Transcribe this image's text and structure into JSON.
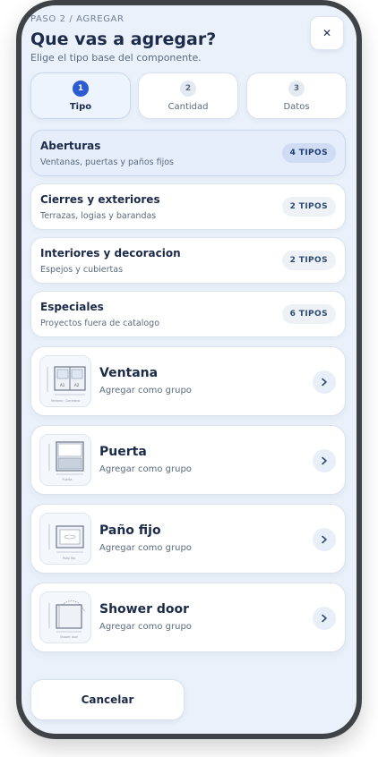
{
  "header": {
    "step_label": "PASO 2 / AGREGAR",
    "title": "Que vas a agregar?",
    "subtitle": "Elige el tipo base del componente.",
    "close_glyph": "✕"
  },
  "tabs": [
    {
      "number": "1",
      "label": "Tipo",
      "active": true
    },
    {
      "number": "2",
      "label": "Cantidad",
      "active": false
    },
    {
      "number": "3",
      "label": "Datos",
      "active": false
    }
  ],
  "categories": [
    {
      "title": "Aberturas",
      "description": "Ventanas, puertas y paños fijos",
      "badge": "4 TIPOS",
      "active": true
    },
    {
      "title": "Cierres y exteriores",
      "description": "Terrazas, logias y barandas",
      "badge": "2 TIPOS",
      "active": false
    },
    {
      "title": "Interiores y decoracion",
      "description": "Espejos y cubiertas",
      "badge": "2 TIPOS",
      "active": false
    },
    {
      "title": "Especiales",
      "description": "Proyectos fuera de catalogo",
      "badge": "6 TIPOS",
      "active": false
    }
  ],
  "products": [
    {
      "name": "Ventana",
      "subtitle": "Agregar como grupo",
      "icon": "window-icon",
      "thumb_caption": "Ventana · Corredera",
      "thumb_labels": [
        "A1",
        "A2"
      ]
    },
    {
      "name": "Puerta",
      "subtitle": "Agregar como grupo",
      "icon": "door-icon",
      "thumb_caption": "Puerta"
    },
    {
      "name": "Paño fijo",
      "subtitle": "Agregar como grupo",
      "icon": "fixed-pane-icon",
      "thumb_caption": "Paño fijo"
    },
    {
      "name": "Shower door",
      "subtitle": "Agregar como grupo",
      "icon": "shower-door-icon",
      "thumb_caption": "Shower door"
    }
  ],
  "footer": {
    "cancel_label": "Cancelar"
  },
  "colors": {
    "accent": "#2d5bd1",
    "title": "#1c2b4a",
    "muted": "#5b6a7e",
    "screen_bg": "#eaf1fa",
    "device_frame": "#3f4247"
  }
}
